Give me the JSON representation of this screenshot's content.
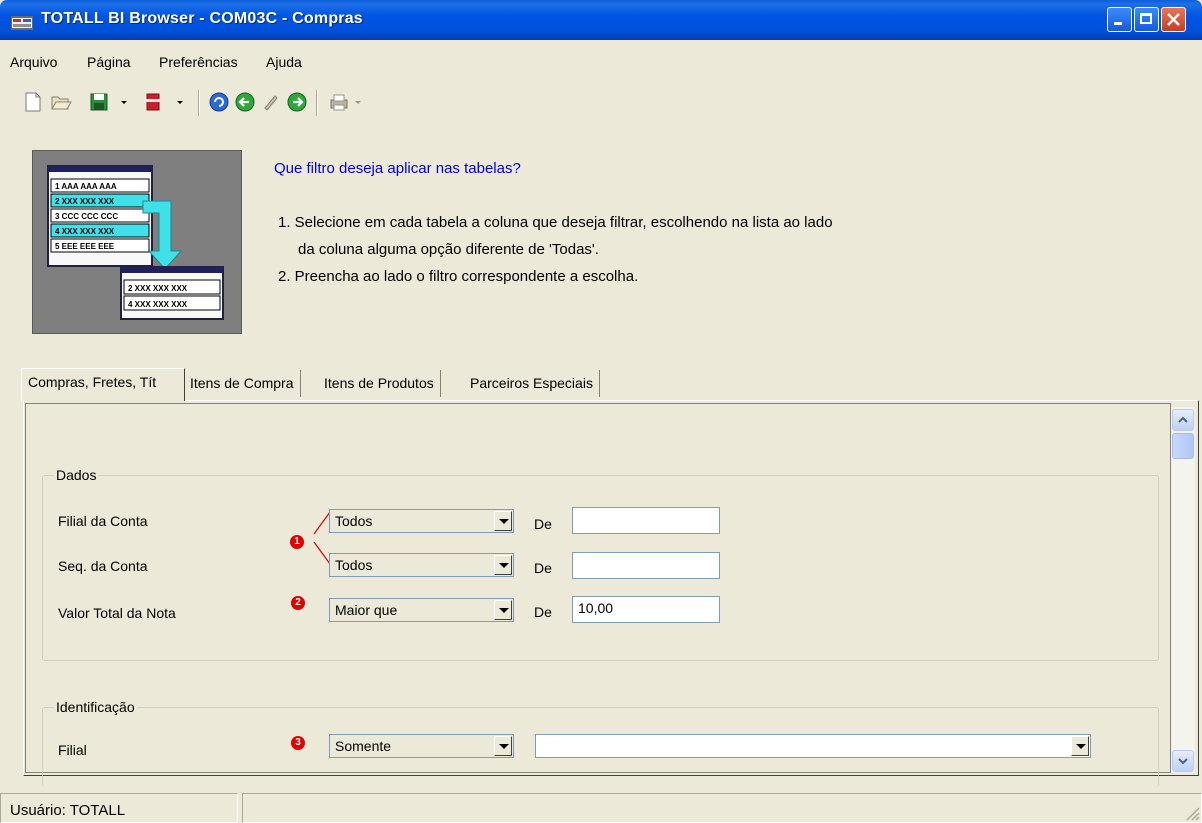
{
  "window": {
    "title": "TOTALL BI Browser - COM03C - Compras"
  },
  "menu": [
    {
      "label": "Arquivo"
    },
    {
      "label": "Página"
    },
    {
      "label": "Preferências"
    },
    {
      "label": "Ajuda"
    }
  ],
  "toolbar": {
    "icons": [
      "new-icon",
      "open-icon",
      "save-icon",
      "dropdown-icon",
      "bookmark-icon",
      "dropdown-icon",
      "refresh-icon",
      "back-icon",
      "edit-icon",
      "forward-icon",
      "print-icon",
      "dropdown-icon"
    ]
  },
  "header": {
    "prompt": "Que filtro deseja aplicar nas tabelas?",
    "step1_line1": "1. Selecione em cada tabela a coluna que deseja filtrar, escolhendo na lista ao lado",
    "step1_line2": "da coluna alguma opção diferente de 'Todas'.",
    "step2": "2. Preencha ao lado o filtro correspondente a escolha.",
    "illustration": {
      "rows_top": [
        "1  AAA AAA AAA",
        "2  XXX XXX XXX",
        "3  CCC CCC CCC",
        "4  XXX XXX XXX",
        "5  EEE EEE EEE"
      ],
      "rows_bottom": [
        "2  XXX XXX XXX",
        "4  XXX XXX XXX"
      ]
    }
  },
  "tabs": [
    {
      "label": "Compras, Fretes, Tít"
    },
    {
      "label": "Itens de Compra"
    },
    {
      "label": "Itens de Produtos"
    },
    {
      "label": "Parceiros Especiais"
    }
  ],
  "groups": {
    "dados": {
      "legend": "Dados",
      "rows": [
        {
          "label": "Filial da Conta",
          "operator": "Todos",
          "de_label": "De",
          "value": ""
        },
        {
          "label": "Seq. da Conta",
          "operator": "Todos",
          "de_label": "De",
          "value": ""
        },
        {
          "label": "Valor Total da Nota",
          "operator": "Maior que",
          "de_label": "De",
          "value": "10,00"
        }
      ]
    },
    "identificacao": {
      "legend": "Identificação",
      "rows": [
        {
          "label": "Filial",
          "operator": "Somente",
          "value": ""
        }
      ]
    }
  },
  "callouts": [
    "1",
    "2",
    "3"
  ],
  "status": {
    "user": "Usuário: TOTALL"
  },
  "colors": {
    "titlebar": "#0054e3",
    "prompt_text": "#0000e0",
    "callout": "#e00000",
    "window_bg": "#ece9d8"
  }
}
